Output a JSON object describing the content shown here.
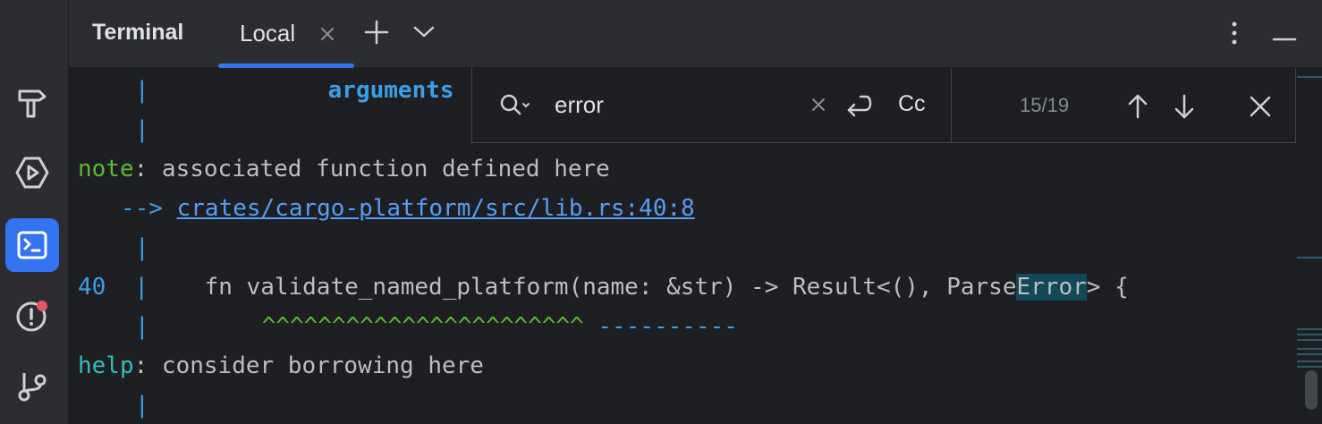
{
  "header": {
    "panel_title": "Terminal",
    "tab_label": "Local",
    "add_icon": "plus-icon",
    "dropdown_icon": "chevron-down-icon",
    "more_icon": "vertical-dots-icon",
    "minimize_icon": "minimize-icon"
  },
  "sidebar": {
    "items": [
      {
        "icon": "hammer-icon"
      },
      {
        "icon": "run-icon"
      },
      {
        "icon": "terminal-icon",
        "active": true
      },
      {
        "icon": "problems-icon"
      },
      {
        "icon": "git-branch-icon"
      }
    ]
  },
  "search": {
    "query": "error",
    "case_label": "Cc",
    "match_count": "15/19"
  },
  "terminal": {
    "arguments": "arguments",
    "pipe": "|",
    "note_label": "note",
    "note_text": ": associated function defined here",
    "arrow": "-->",
    "link": "crates/cargo-platform/src/lib.rs:40:8",
    "line_no": "40",
    "code_before": "    fn validate_named_platform(name: &str) -> Result<(), Parse",
    "code_match": "Error",
    "code_after": "> {",
    "carets": "^^^^^^^^^^^^^^^^^^^^^^^",
    "dashes": "----------",
    "help_label": "help",
    "help_text": ": consider borrowing here"
  },
  "colors": {
    "accent": "#3574f0",
    "note": "#5fb932",
    "help": "#2fbfbf",
    "pipe": "#3d9ee8",
    "highlight": "#114957"
  }
}
